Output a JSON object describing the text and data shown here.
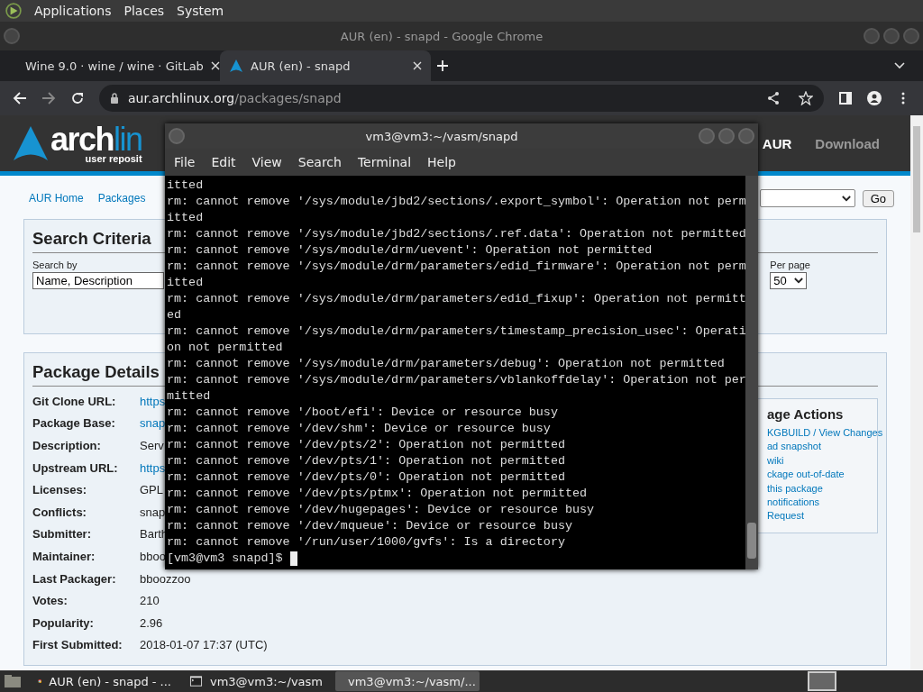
{
  "top_panel": {
    "menus": [
      "Applications",
      "Places",
      "System"
    ]
  },
  "browser": {
    "title": "AUR (en) - snapd - Google Chrome",
    "tabs": [
      {
        "label": "Wine 9.0 · wine / wine · GitLab",
        "selected": false,
        "kind": "wine"
      },
      {
        "label": "AUR (en) - snapd",
        "selected": true,
        "kind": "arch"
      }
    ],
    "address": {
      "host": "aur.archlinux.org",
      "path": "/packages/snapd"
    }
  },
  "page": {
    "header": {
      "logo_main": "arch",
      "logo_light": "lin",
      "logo_sub": "user reposit",
      "nav": [
        {
          "label": "AUR",
          "selected": true
        },
        {
          "label": "Download",
          "selected": false
        }
      ]
    },
    "breadcrumbs": [
      "AUR Home",
      "Packages"
    ],
    "go_button": "Go",
    "search": {
      "title": "Search Criteria",
      "field_label": "Search by",
      "field_value": "Name, Description",
      "per_page_label": "Per page",
      "per_page_value": "50"
    },
    "details": {
      "title": "Package Details",
      "rows": [
        {
          "label": "Git Clone URL:",
          "value": "https",
          "kind": "link"
        },
        {
          "label": "Package Base:",
          "value": "snap",
          "kind": "link"
        },
        {
          "label": "Description:",
          "value": "Serv",
          "kind": "text"
        },
        {
          "label": "Upstream URL:",
          "value": "https",
          "kind": "link"
        },
        {
          "label": "Licenses:",
          "value": "GPL",
          "kind": "text"
        },
        {
          "label": "Conflicts:",
          "value": "snap",
          "kind": "text"
        },
        {
          "label": "Submitter:",
          "value": "Barth",
          "kind": "text"
        },
        {
          "label": "Maintainer:",
          "value": "bboo",
          "kind": "text"
        },
        {
          "label": "Last Packager:",
          "value": "bboozzoo",
          "kind": "text"
        },
        {
          "label": "Votes:",
          "value": "210",
          "kind": "text"
        },
        {
          "label": "Popularity:",
          "value": "2.96",
          "kind": "text"
        },
        {
          "label": "First Submitted:",
          "value": "2018-01-07 17:37 (UTC)",
          "kind": "text"
        }
      ]
    },
    "actions": {
      "title": "age Actions",
      "links": [
        "KGBUILD / View Changes",
        "ad snapshot",
        "wiki",
        "ckage out-of-date",
        "this package",
        "notifications",
        "Request"
      ]
    }
  },
  "terminal": {
    "title": "vm3@vm3:~/vasm/snapd",
    "menu": [
      "File",
      "Edit",
      "View",
      "Search",
      "Terminal",
      "Help"
    ],
    "lines": [
      "itted",
      "rm: cannot remove '/sys/module/jbd2/sections/.export_symbol': Operation not perm",
      "itted",
      "rm: cannot remove '/sys/module/jbd2/sections/.ref.data': Operation not permitted",
      "rm: cannot remove '/sys/module/drm/uevent': Operation not permitted",
      "rm: cannot remove '/sys/module/drm/parameters/edid_firmware': Operation not perm",
      "itted",
      "rm: cannot remove '/sys/module/drm/parameters/edid_fixup': Operation not permitt",
      "ed",
      "rm: cannot remove '/sys/module/drm/parameters/timestamp_precision_usec': Operati",
      "on not permitted",
      "rm: cannot remove '/sys/module/drm/parameters/debug': Operation not permitted",
      "rm: cannot remove '/sys/module/drm/parameters/vblankoffdelay': Operation not per",
      "mitted",
      "rm: cannot remove '/boot/efi': Device or resource busy",
      "rm: cannot remove '/dev/shm': Device or resource busy",
      "rm: cannot remove '/dev/pts/2': Operation not permitted",
      "rm: cannot remove '/dev/pts/1': Operation not permitted",
      "rm: cannot remove '/dev/pts/0': Operation not permitted",
      "rm: cannot remove '/dev/pts/ptmx': Operation not permitted",
      "rm: cannot remove '/dev/hugepages': Device or resource busy",
      "rm: cannot remove '/dev/mqueue': Device or resource busy",
      "rm: cannot remove '/run/user/1000/gvfs': Is a directory"
    ],
    "prompt": "[vm3@vm3 snapd]$"
  },
  "taskbar": {
    "items": [
      {
        "label": "AUR (en) - snapd - ...",
        "selected": false,
        "kind": "browser"
      },
      {
        "label": "vm3@vm3:~/vasm",
        "selected": false,
        "kind": "terminal"
      },
      {
        "label": "vm3@vm3:~/vasm/...",
        "selected": true,
        "kind": "terminal"
      }
    ]
  }
}
